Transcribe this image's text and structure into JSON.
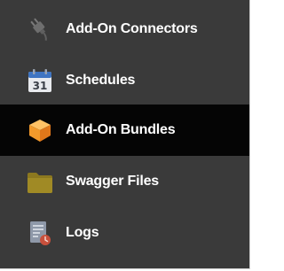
{
  "menu": {
    "items": [
      {
        "label": "Add-On Connectors",
        "icon": "plug-icon",
        "active": false
      },
      {
        "label": "Schedules",
        "icon": "calendar-icon",
        "calendar_day": "31",
        "active": false
      },
      {
        "label": "Add-On Bundles",
        "icon": "cube-icon",
        "active": true
      },
      {
        "label": "Swagger Files",
        "icon": "folder-icon",
        "active": false
      },
      {
        "label": "Logs",
        "icon": "log-document-icon",
        "active": false
      }
    ]
  },
  "colors": {
    "background": "#3a3a3a",
    "active_background": "#050505",
    "text": "#ffffff",
    "calendar_blue": "#3e74c2",
    "cube_orange": "#f39a2b",
    "folder_olive": "#a08a25",
    "log_red": "#c8503c"
  }
}
